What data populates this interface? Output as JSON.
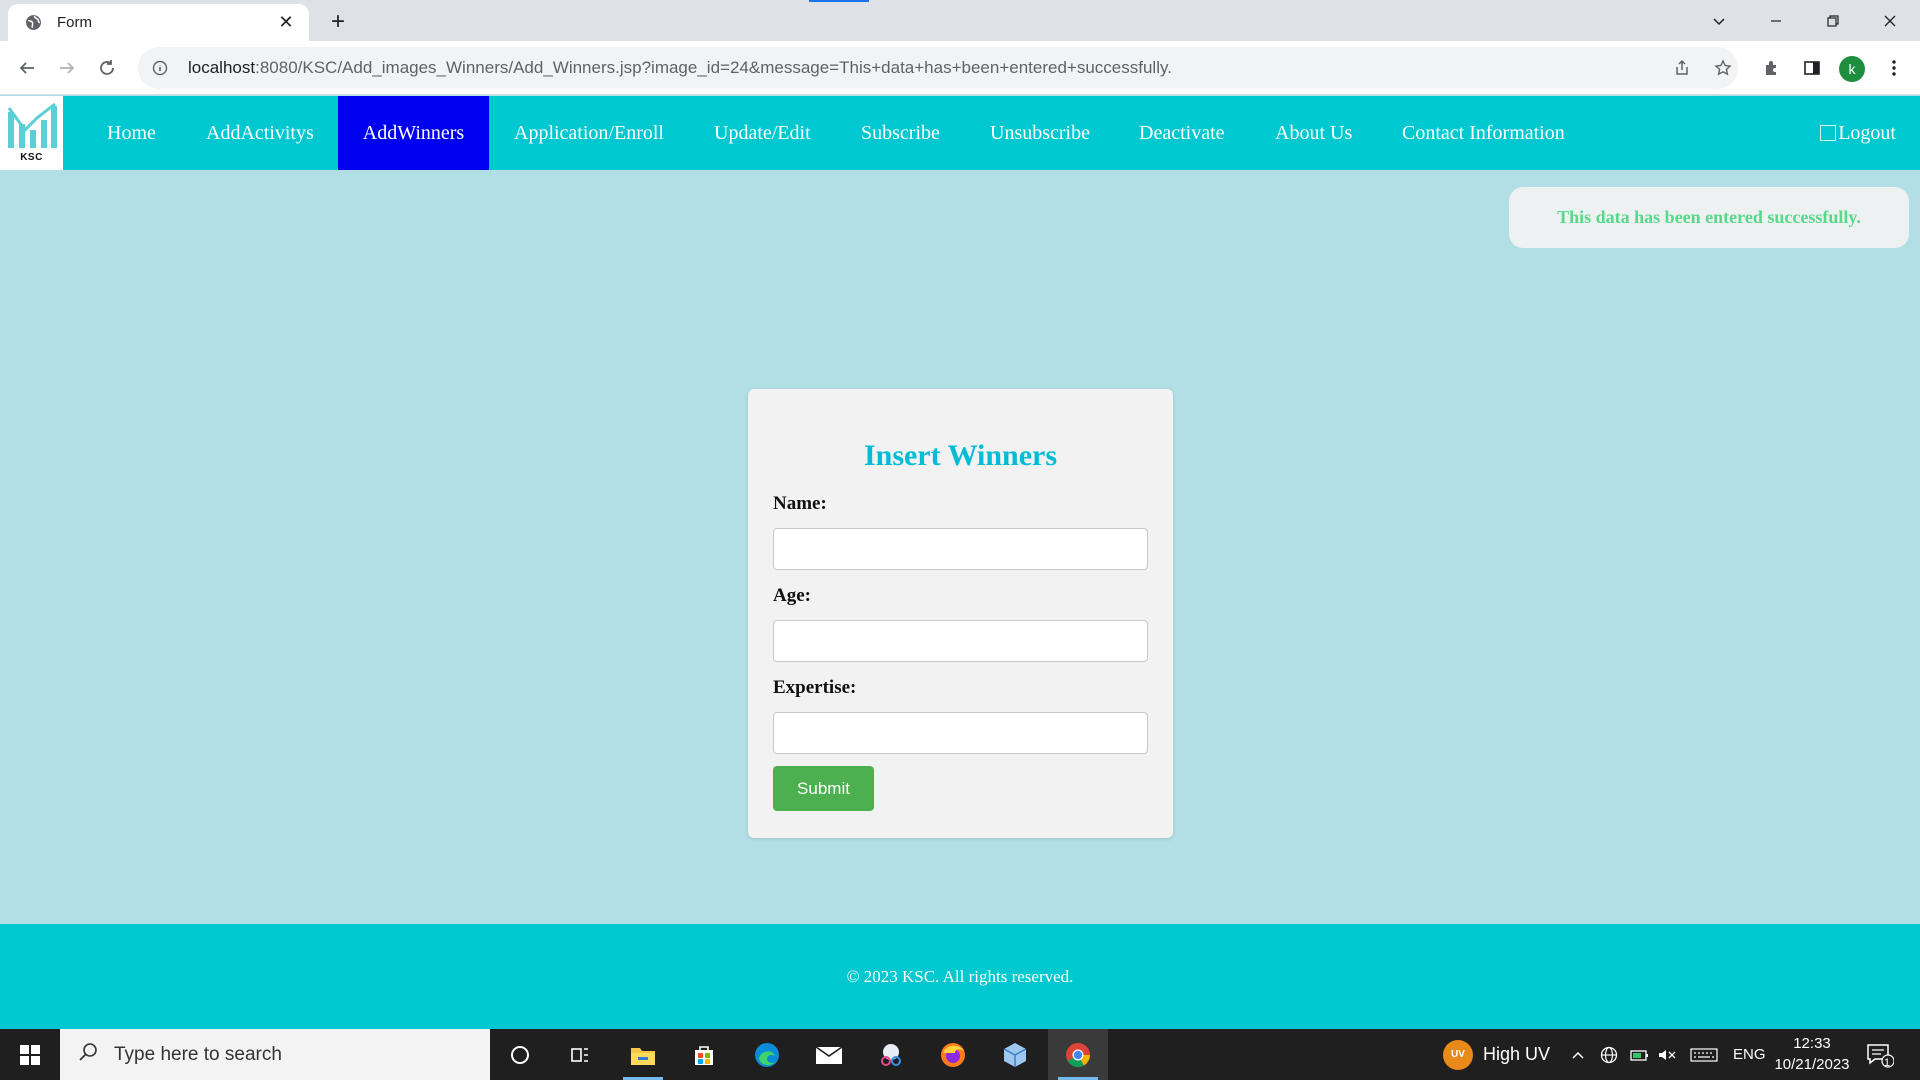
{
  "browser": {
    "tab_title": "Form",
    "url_host": "localhost",
    "url_rest": ":8080/KSC/Add_images_Winners/Add_Winners.jsp?image_id=24&message=This+data+has+been+entered+successfully.",
    "profile_initial": "k"
  },
  "site": {
    "logo_text": "KSC",
    "nav": [
      {
        "label": "Home"
      },
      {
        "label": "AddActivitys"
      },
      {
        "label": "AddWinners",
        "active": true
      },
      {
        "label": "Application/Enroll"
      },
      {
        "label": "Update/Edit"
      },
      {
        "label": "Subscribe"
      },
      {
        "label": "Unsubscribe"
      },
      {
        "label": "Deactivate"
      },
      {
        "label": "About Us"
      },
      {
        "label": "Contact Information"
      }
    ],
    "logout_label": "Logout"
  },
  "toast": {
    "message": "This data has been entered successfully."
  },
  "form": {
    "title": "Insert Winners",
    "name_label": "Name:",
    "name_value": "",
    "age_label": "Age:",
    "age_value": "",
    "expertise_label": "Expertise:",
    "expertise_value": "",
    "submit_label": "Submit"
  },
  "footer": {
    "text": "© 2023 KSC. All rights reserved."
  },
  "taskbar": {
    "search_placeholder": "Type here to search",
    "weather_badge": "UV",
    "weather_text": "High UV",
    "language": "ENG",
    "time": "12:33",
    "date": "10/21/2023",
    "notification_count": "1"
  },
  "colors": {
    "page_bg": "#b2dfe5",
    "nav_bg": "#00c8d0",
    "nav_active": "#0000f0",
    "title_color": "#00bcd4",
    "submit_bg": "#4caf50",
    "toast_text": "#58d88a"
  }
}
